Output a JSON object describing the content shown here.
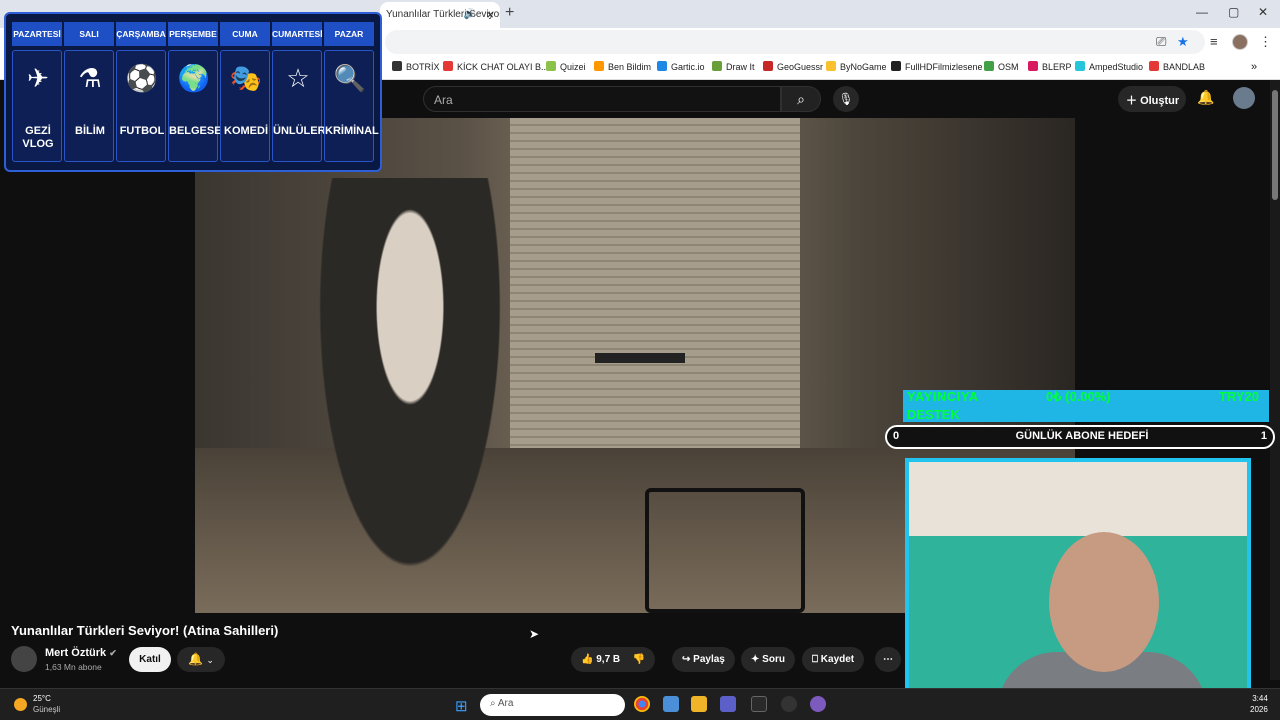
{
  "browser": {
    "tab_title": "Yunanlılar Türkleri Seviyor!",
    "tab_audio_icon": "speaker-icon",
    "new_tab": "+",
    "window_controls": [
      "—",
      "▢",
      "✕"
    ]
  },
  "bookmarks": [
    {
      "label": "BOTRİX",
      "color": "#333333"
    },
    {
      "label": "KİCK CHAT OLAYI B...",
      "color": "#e53935"
    },
    {
      "label": "Quizei",
      "color": "#8bc34a"
    },
    {
      "label": "Ben Bildim",
      "color": "#ff9800"
    },
    {
      "label": "Gartic.io",
      "color": "#1e88e5"
    },
    {
      "label": "Draw It",
      "color": "#689f38"
    },
    {
      "label": "GeoGuessr",
      "color": "#c62828"
    },
    {
      "label": "ByNoGame",
      "color": "#fbc02d"
    },
    {
      "label": "FullHDFilmizlesene",
      "color": "#212121"
    },
    {
      "label": "OSM",
      "color": "#43a047"
    },
    {
      "label": "BLERP",
      "color": "#d81b60"
    },
    {
      "label": "AmpedStudio",
      "color": "#26c6da"
    },
    {
      "label": "BANDLAB",
      "color": "#e53935"
    }
  ],
  "youtube": {
    "search_placeholder": "Ara",
    "create_label": "Oluştur",
    "video_title": "Yunanlılar Türkleri Seviyor! (Atina Sahilleri)",
    "channel_name": "Mert Öztürk",
    "channel_subs": "1,63 Mn abone",
    "join_label": "Katıl",
    "likes": "9,7 B",
    "share_label": "Paylaş",
    "ask_label": "Soru",
    "save_label": "Kaydet"
  },
  "schedule": [
    {
      "day": "PAZARTESİ",
      "label": "GEZİ VLOG",
      "icon": "✈"
    },
    {
      "day": "SALI",
      "label": "BİLİM",
      "icon": "⚗"
    },
    {
      "day": "ÇARŞAMBA",
      "label": "FUTBOL",
      "icon": "⚽"
    },
    {
      "day": "PERŞEMBE",
      "label": "BELGESEL",
      "icon": "🌍"
    },
    {
      "day": "CUMA",
      "label": "KOMEDİ",
      "icon": "🎭"
    },
    {
      "day": "CUMARTESİ",
      "label": "ÜNLÜLER",
      "icon": "☆"
    },
    {
      "day": "PAZAR",
      "label": "KRİMİNAL",
      "icon": "🔍"
    }
  ],
  "stream": {
    "donation_line1": "YAYINCIYA",
    "donation_line2": "DESTEK",
    "donation_amount": "0₺ (0.00%)",
    "donation_goal": "TRY20",
    "subgoal_min": "0",
    "subgoal_title": "GÜNLÜK ABONE HEDEFİ",
    "subgoal_max": "1"
  },
  "taskbar": {
    "temperature": "25°C",
    "condition": "Güneşli",
    "search_placeholder": "Ara",
    "time": "3:44",
    "year": "2026"
  }
}
